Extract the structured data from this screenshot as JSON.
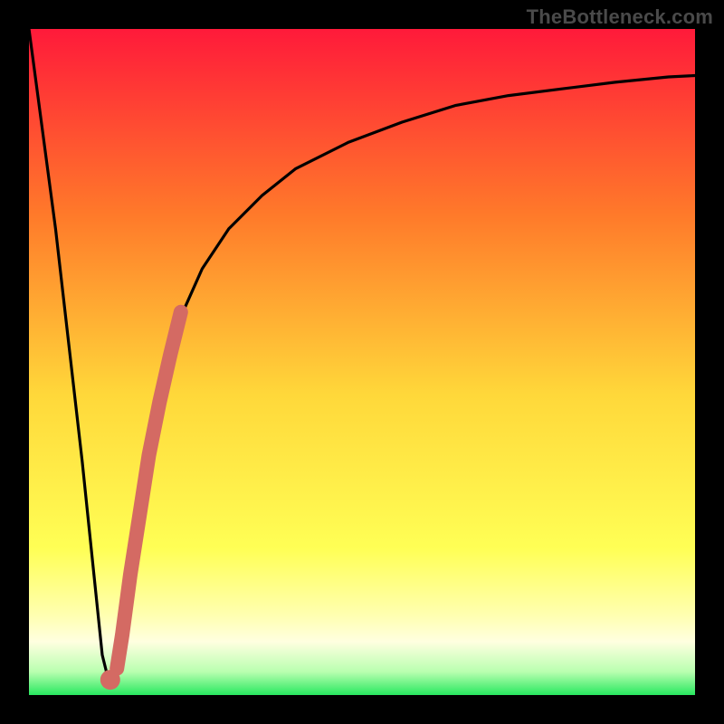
{
  "watermark": "TheBottleneck.com",
  "colors": {
    "gradient_top": "#ff1a3a",
    "gradient_mid1": "#ff7a2a",
    "gradient_mid2": "#ffd83a",
    "gradient_mid3": "#ffff55",
    "gradient_band": "#ffffb0",
    "gradient_green": "#28e85f",
    "curve_stroke": "#000000",
    "highlight": "#d46a63"
  },
  "chart_data": {
    "type": "line",
    "title": "",
    "xlabel": "",
    "ylabel": "",
    "xlim": [
      0,
      100
    ],
    "ylim": [
      0,
      100
    ],
    "series": [
      {
        "name": "bottleneck-curve",
        "x": [
          0,
          4,
          8,
          11,
          12,
          13,
          15,
          18,
          22,
          26,
          30,
          35,
          40,
          48,
          56,
          64,
          72,
          80,
          88,
          96,
          100
        ],
        "y": [
          100,
          70,
          35,
          6,
          2,
          3,
          18,
          40,
          55,
          64,
          70,
          75,
          79,
          83,
          86,
          88.5,
          90,
          91,
          92,
          92.8,
          93
        ]
      },
      {
        "name": "highlight-segment",
        "x": [
          13.2,
          14.0,
          15.2,
          16.6,
          18.0,
          19.6,
          21.2,
          22.8
        ],
        "y": [
          4.0,
          9.0,
          18.0,
          27.0,
          36.0,
          44.0,
          51.0,
          57.5
        ]
      },
      {
        "name": "highlight-dot",
        "x": [
          12.2
        ],
        "y": [
          2.3
        ]
      }
    ]
  }
}
